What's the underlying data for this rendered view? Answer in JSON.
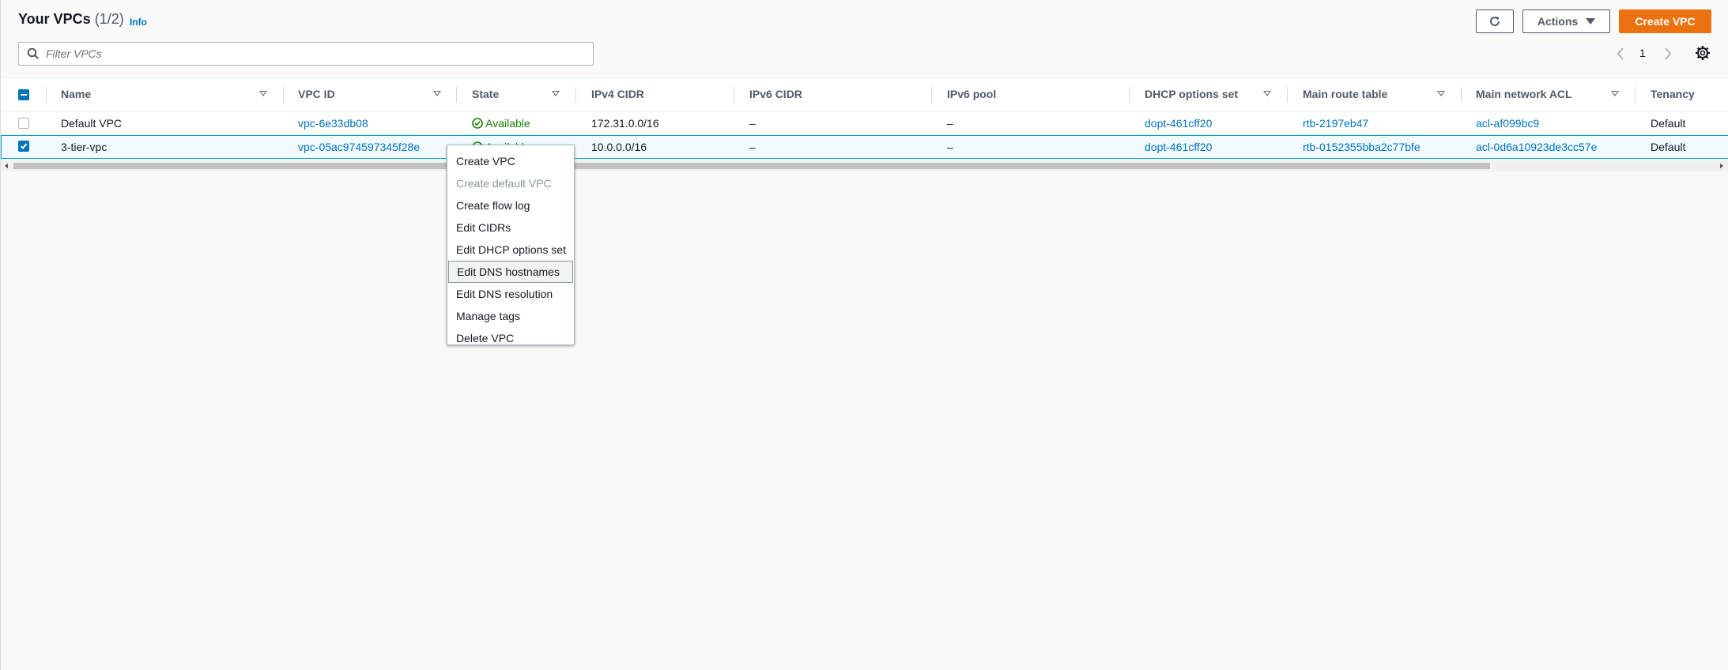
{
  "header": {
    "title": "Your VPCs",
    "count": "(1/2)",
    "info": "Info",
    "actions_label": "Actions",
    "create_label": "Create VPC"
  },
  "filter": {
    "placeholder": "Filter VPCs"
  },
  "pagination": {
    "page": "1"
  },
  "table": {
    "columns": [
      "Name",
      "VPC ID",
      "State",
      "IPv4 CIDR",
      "IPv6 CIDR",
      "IPv6 pool",
      "DHCP options set",
      "Main route table",
      "Main network ACL",
      "Tenancy"
    ],
    "rows": [
      {
        "name": "Default VPC",
        "vpc_id": "vpc-6e33db08",
        "state": "Available",
        "ipv4": "172.31.0.0/16",
        "ipv6": "–",
        "ipv6_pool": "–",
        "dhcp": "dopt-461cff20",
        "route_table": "rtb-2197eb47",
        "acl": "acl-af099bc9",
        "tenancy": "Default",
        "selected": false
      },
      {
        "name": "3-tier-vpc",
        "vpc_id": "vpc-05ac974597345f28e",
        "state": "Available",
        "ipv4": "10.0.0.0/16",
        "ipv6": "–",
        "ipv6_pool": "–",
        "dhcp": "dopt-461cff20",
        "route_table": "rtb-0152355bba2c77bfe",
        "acl": "acl-0d6a10923de3cc57e",
        "tenancy": "Default",
        "selected": true
      }
    ]
  },
  "context_menu": {
    "items": [
      {
        "label": "Create VPC",
        "disabled": false
      },
      {
        "label": "Create default VPC",
        "disabled": true
      },
      {
        "label": "Create flow log",
        "disabled": false
      },
      {
        "label": "Edit CIDRs",
        "disabled": false
      },
      {
        "label": "Edit DHCP options set",
        "disabled": false
      },
      {
        "label": "Edit DNS hostnames",
        "disabled": false,
        "hovered": true
      },
      {
        "label": "Edit DNS resolution",
        "disabled": false
      },
      {
        "label": "Manage tags",
        "disabled": false
      },
      {
        "label": "Delete VPC",
        "disabled": false
      }
    ]
  },
  "colors": {
    "accent": "#ec7211",
    "link": "#0073bb",
    "available": "#1d8102",
    "selected_row": "#f1faff",
    "selected_border": "#00a1c9"
  },
  "icons": [
    "refresh-icon",
    "caret-down-icon",
    "search-icon",
    "chevron-left-icon",
    "chevron-right-icon",
    "gear-icon",
    "check-circle-icon",
    "sort-icon"
  ]
}
